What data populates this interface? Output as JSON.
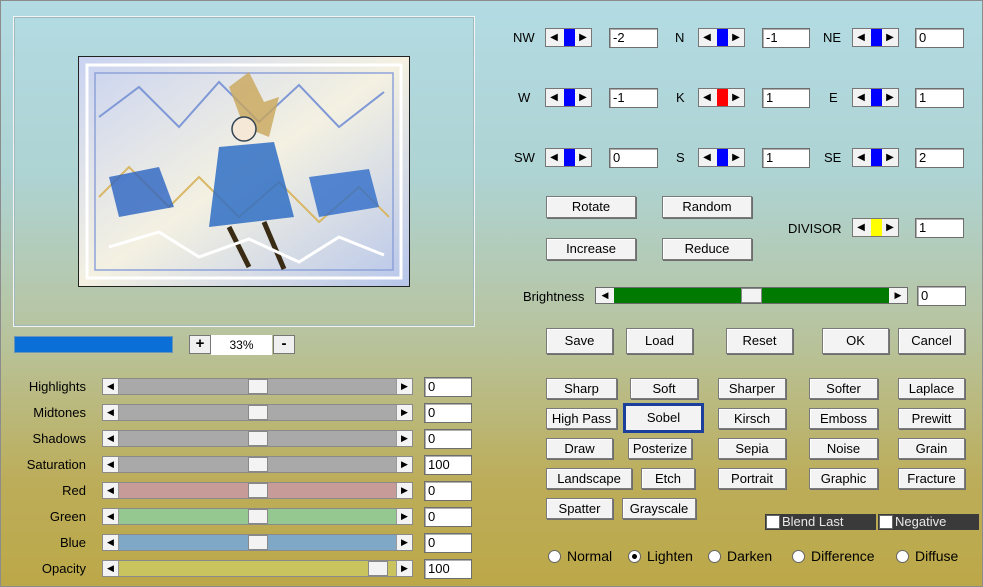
{
  "colors": {
    "accent": "#0a6fd6",
    "thumb_blue": "#0000ff",
    "thumb_red": "#ff0000",
    "thumb_yellow": "#ffff00",
    "brightness_green": "#007a00"
  },
  "zoom": {
    "plus": "+",
    "minus": "-",
    "value": "33%"
  },
  "matrix": {
    "nw": {
      "label": "NW",
      "value": "-2"
    },
    "n": {
      "label": "N",
      "value": "-1"
    },
    "ne": {
      "label": "NE",
      "value": "0"
    },
    "w": {
      "label": "W",
      "value": "-1"
    },
    "k": {
      "label": "K",
      "value": "1"
    },
    "e": {
      "label": "E",
      "value": "1"
    },
    "sw": {
      "label": "SW",
      "value": "0"
    },
    "s": {
      "label": "S",
      "value": "1"
    },
    "se": {
      "label": "SE",
      "value": "2"
    }
  },
  "actions": {
    "rotate": "Rotate",
    "random": "Random",
    "increase": "Increase",
    "reduce": "Reduce"
  },
  "divisor": {
    "label": "DIVISOR",
    "value": "1"
  },
  "brightness": {
    "label": "Brightness",
    "value": "0",
    "level": 0.5
  },
  "file_buttons": {
    "save": "Save",
    "load": "Load",
    "reset": "Reset",
    "ok": "OK",
    "cancel": "Cancel"
  },
  "adjustments": [
    {
      "label": "Highlights",
      "value": "0",
      "level": 0.5,
      "color": "#a9a9a9"
    },
    {
      "label": "Midtones",
      "value": "0",
      "level": 0.5,
      "color": "#a9a9a9"
    },
    {
      "label": "Shadows",
      "value": "0",
      "level": 0.5,
      "color": "#a9a9a9"
    },
    {
      "label": "Saturation",
      "value": "100",
      "level": 0.5,
      "color": "#a9a9a9"
    },
    {
      "label": "Red",
      "value": "0",
      "level": 0.5,
      "color": "#c79b97"
    },
    {
      "label": "Green",
      "value": "0",
      "level": 0.5,
      "color": "#95c790"
    },
    {
      "label": "Blue",
      "value": "0",
      "level": 0.5,
      "color": "#7fa8c6"
    },
    {
      "label": "Opacity",
      "value": "100",
      "level": 0.97,
      "color": "#c9c45e"
    }
  ],
  "filters": {
    "sharp": "Sharp",
    "soft": "Soft",
    "sharper": "Sharper",
    "softer": "Softer",
    "laplace": "Laplace",
    "high_pass": "High Pass",
    "sobel": "Sobel",
    "kirsch": "Kirsch",
    "emboss": "Emboss",
    "prewitt": "Prewitt",
    "draw": "Draw",
    "posterize": "Posterize",
    "sepia": "Sepia",
    "noise": "Noise",
    "grain": "Grain",
    "landscape": "Landscape",
    "etch": "Etch",
    "portrait": "Portrait",
    "graphic": "Graphic",
    "fracture": "Fracture",
    "spatter": "Spatter",
    "grayscale": "Grayscale",
    "selected": "sobel"
  },
  "options": {
    "blend_last": "Blend Last",
    "negative": "Negative"
  },
  "modes": {
    "normal": "Normal",
    "lighten": "Lighten",
    "darken": "Darken",
    "difference": "Difference",
    "diffuse": "Diffuse",
    "selected": "lighten"
  }
}
